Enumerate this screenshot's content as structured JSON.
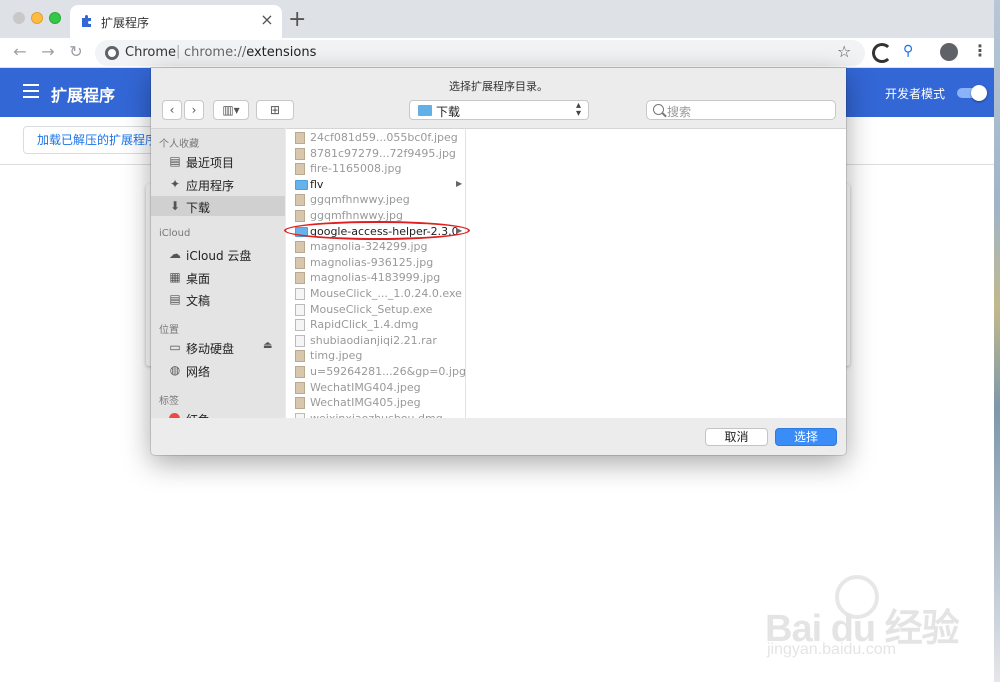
{
  "browser": {
    "tab_title": "扩展程序",
    "tab_close": "×",
    "new_tab": "+",
    "site_label": "Chrome",
    "url_scheme": "chrome://",
    "url_path": "extensions",
    "back": "←",
    "forward": "→",
    "reload": "↻",
    "star": "☆",
    "menu": "⋮"
  },
  "extensions_page": {
    "title": "扩展程序",
    "dev_mode_label": "开发者模式",
    "dev_mode_on": true,
    "load_unpacked_label": "加载已解压的扩展程序"
  },
  "dialog": {
    "title": "选择扩展程序目录。",
    "path": "下载",
    "search_placeholder": "搜索",
    "nav_back": "‹",
    "nav_forward": "›",
    "view_icon": "▥▾",
    "new_folder_icon": "⊞",
    "sidebar": {
      "favorites_header": "个人收藏",
      "favorites": [
        {
          "label": "最近项目",
          "icon": "recent-icon",
          "glyph": "▤"
        },
        {
          "label": "应用程序",
          "icon": "applications-icon",
          "glyph": "✦"
        },
        {
          "label": "下载",
          "icon": "downloads-icon",
          "glyph": "⬇",
          "selected": true
        }
      ],
      "icloud_header": "iCloud",
      "icloud": [
        {
          "label": "iCloud 云盘",
          "icon": "cloud-icon",
          "glyph": "☁"
        },
        {
          "label": "桌面",
          "icon": "desktop-icon",
          "glyph": "▦"
        },
        {
          "label": "文稿",
          "icon": "documents-icon",
          "glyph": "▤"
        }
      ],
      "locations_header": "位置",
      "locations": [
        {
          "label": "移动硬盘",
          "icon": "external-drive-icon",
          "glyph": "▭",
          "eject": "⏏"
        },
        {
          "label": "网络",
          "icon": "network-icon",
          "glyph": "◍"
        }
      ],
      "tags_header": "标签",
      "tags": [
        {
          "label": "红色",
          "color": "#ee4a45"
        }
      ]
    },
    "files": [
      {
        "name": "24cf081d59...055bc0f.jpeg",
        "kind": "image"
      },
      {
        "name": "8781c97279...72f9495.jpg",
        "kind": "image"
      },
      {
        "name": "fire-1165008.jpg",
        "kind": "image"
      },
      {
        "name": "flv",
        "kind": "folder",
        "enabled": true
      },
      {
        "name": "ggqmfhnwwy.jpeg",
        "kind": "image"
      },
      {
        "name": "ggqmfhnwwy.jpg",
        "kind": "image"
      },
      {
        "name": "google-access-helper-2.3.0",
        "kind": "folder",
        "enabled": true,
        "highlighted": true
      },
      {
        "name": "magnolia-324299.jpg",
        "kind": "image"
      },
      {
        "name": "magnolias-936125.jpg",
        "kind": "image"
      },
      {
        "name": "magnolias-4183999.jpg",
        "kind": "image"
      },
      {
        "name": "MouseClick_..._1.0.24.0.exe",
        "kind": "doc"
      },
      {
        "name": "MouseClick_Setup.exe",
        "kind": "doc"
      },
      {
        "name": "RapidClick_1.4.dmg",
        "kind": "doc"
      },
      {
        "name": "shubiaodianjiqi2.21.rar",
        "kind": "doc"
      },
      {
        "name": "timg.jpeg",
        "kind": "image"
      },
      {
        "name": "u=59264281...26&gp=0.jpg",
        "kind": "image"
      },
      {
        "name": "WechatIMG404.jpeg",
        "kind": "image"
      },
      {
        "name": "WechatIMG405.jpeg",
        "kind": "image"
      },
      {
        "name": "weixinxiaozhushou.dmg",
        "kind": "doc"
      }
    ],
    "cancel_label": "取消",
    "choose_label": "选择"
  },
  "watermark": {
    "main": "Bai du 经验",
    "sub": "jingyan.baidu.com"
  },
  "colors": {
    "header_blue": "#3367d6",
    "primary_button": "#3a8cf6",
    "highlight_circle": "#e02020"
  }
}
